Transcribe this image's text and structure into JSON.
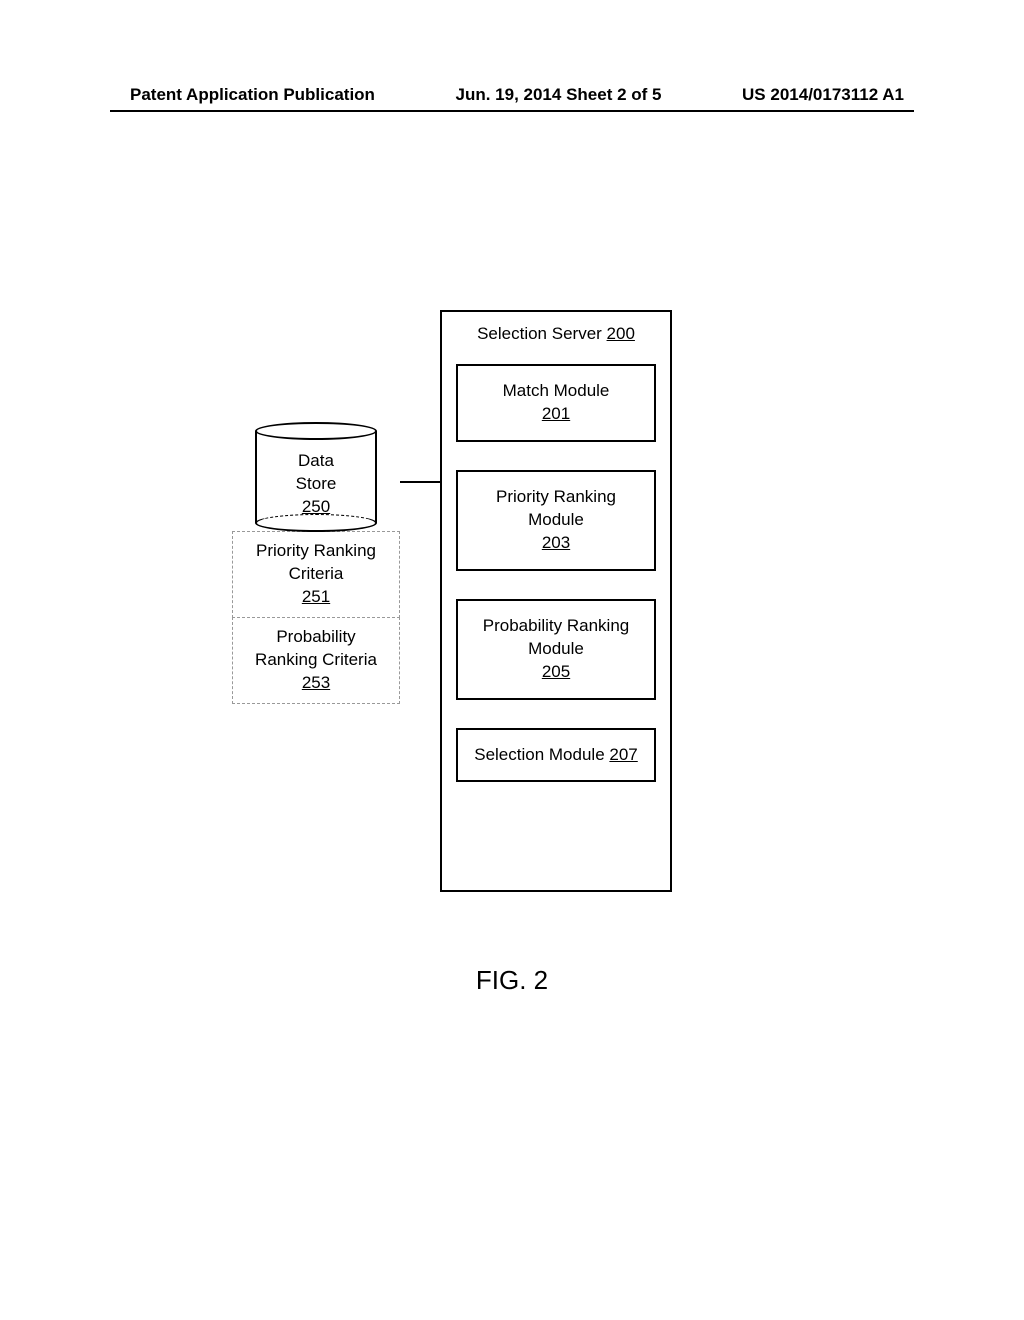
{
  "header": {
    "left": "Patent Application Publication",
    "mid": "Jun. 19, 2014  Sheet 2 of 5",
    "right": "US 2014/0173112 A1"
  },
  "datastore": {
    "label_line1": "Data",
    "label_line2": "Store",
    "ref": "250",
    "sub1_line1": "Priority Ranking",
    "sub1_line2": "Criteria",
    "sub1_ref": "251",
    "sub2_line1": "Probability",
    "sub2_line2": "Ranking Criteria",
    "sub2_ref": "253"
  },
  "server": {
    "title": "Selection Server",
    "ref": "200",
    "mod1_line1": "Match Module",
    "mod1_ref": "201",
    "mod2_line1": "Priority Ranking",
    "mod2_line2": "Module",
    "mod2_ref": "203",
    "mod3_line1": "Probability Ranking",
    "mod3_line2": "Module",
    "mod3_ref": "205",
    "mod4_line1": "Selection Module",
    "mod4_ref": "207"
  },
  "figure_label": "FIG. 2"
}
